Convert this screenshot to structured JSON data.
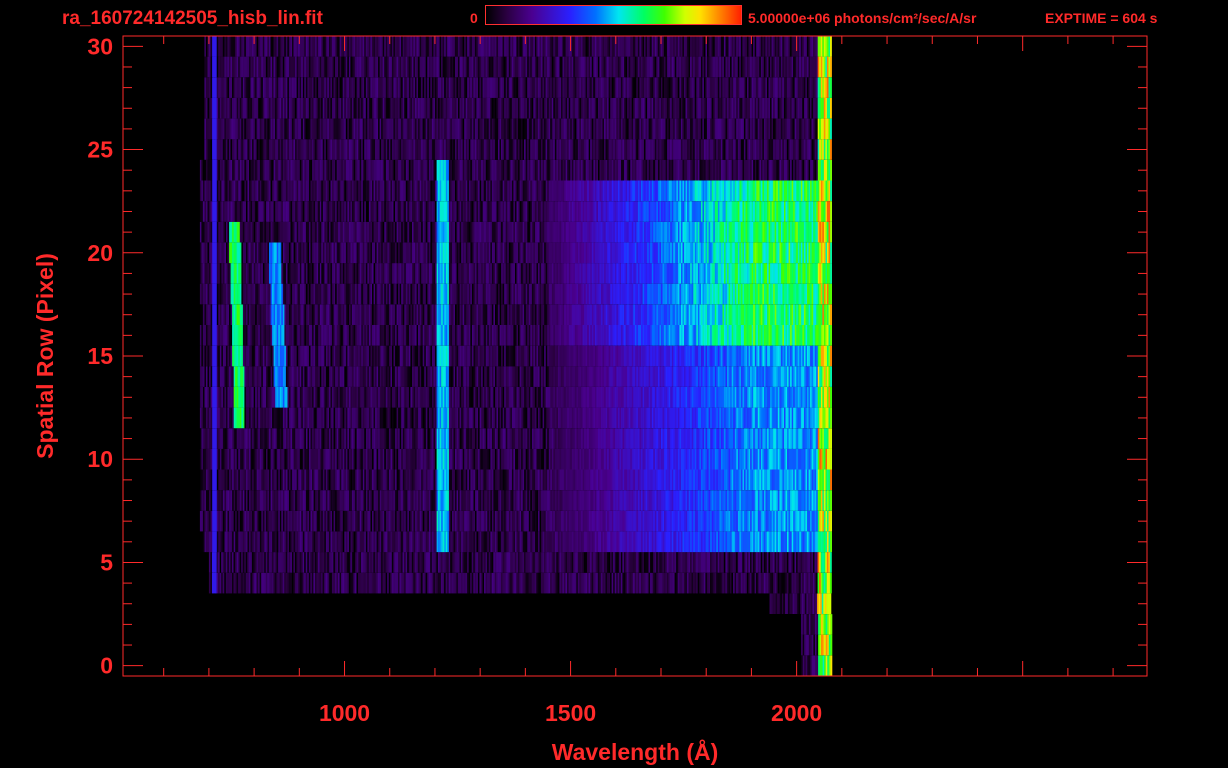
{
  "header": {
    "filename": "ra_160724142505_hisb_lin.fit",
    "colorbar_min": "0",
    "colorbar_max_label": "5.00000e+06 photons/cm²/sec/A/sr",
    "exptime": "EXPTIME = 604 s"
  },
  "colors": {
    "axes": "#ff2a2a",
    "background": "#000000"
  },
  "chart_data": {
    "type": "heatmap",
    "title": "",
    "xlabel": "Wavelength (Å)",
    "ylabel": "Spatial Row (Pixel)",
    "xlim": [
      510,
      2775
    ],
    "ylim": [
      -0.5,
      30.5
    ],
    "x_ticks": [
      1000,
      1500,
      2000
    ],
    "y_ticks": [
      0,
      5,
      10,
      15,
      20,
      25,
      30
    ],
    "colorbar": {
      "min": 0,
      "max": 5000000
    },
    "rows": [
      0,
      30
    ],
    "wavelength_range": [
      680,
      2075
    ],
    "features": [
      {
        "type": "emission_line",
        "wavelength": 760,
        "rows": [
          12,
          21
        ]
      },
      {
        "type": "emission_line",
        "wavelength": 850,
        "rows": [
          13,
          20
        ]
      },
      {
        "type": "emission_line",
        "wavelength": 1216,
        "rows": [
          6,
          24
        ]
      },
      {
        "type": "continuum",
        "wavelength_range": [
          1550,
          2060
        ],
        "rows": [
          6,
          23
        ]
      }
    ]
  }
}
